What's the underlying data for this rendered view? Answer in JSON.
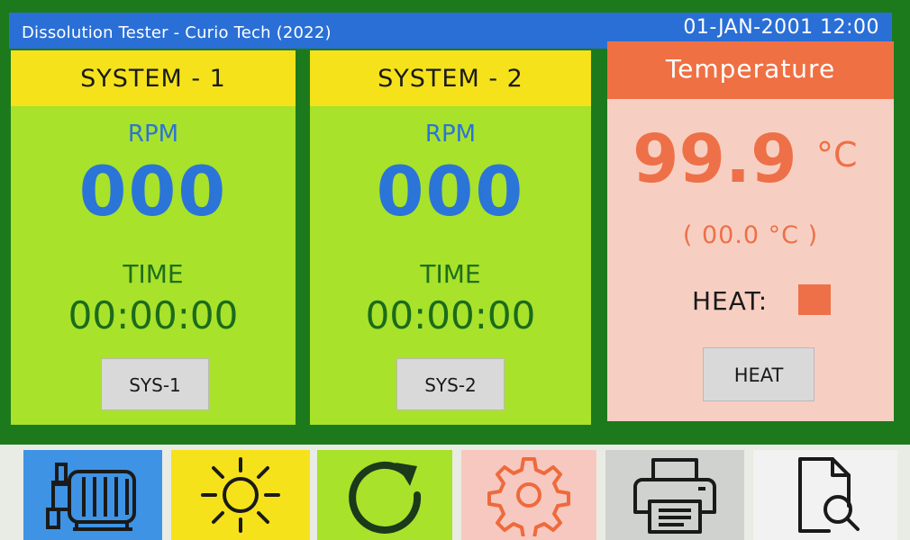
{
  "titlebar": {
    "app_title": "Dissolution Tester - Curio Tech (2022)",
    "datetime": "01-JAN-2001  12:00"
  },
  "systems": [
    {
      "title": "SYSTEM - 1",
      "rpm_label": "RPM",
      "rpm": "000",
      "time_label": "TIME",
      "time": "00:00:00",
      "button": "SYS-1"
    },
    {
      "title": "SYSTEM - 2",
      "rpm_label": "RPM",
      "rpm": "000",
      "time_label": "TIME",
      "time": "00:00:00",
      "button": "SYS-2"
    }
  ],
  "temperature": {
    "title": "Temperature",
    "value": "99.9",
    "unit": "°C",
    "setpoint": "( 00.0 °C )",
    "heat_label": "HEAT:",
    "heat_button": "HEAT"
  },
  "toolbar": [
    {
      "icon": "motor-pump-icon",
      "color": "#3f93e4"
    },
    {
      "icon": "sun-icon",
      "color": "#f6e21a"
    },
    {
      "icon": "refresh-icon",
      "color": "#a8e22a"
    },
    {
      "icon": "gear-icon",
      "color": "#f7c8bf"
    },
    {
      "icon": "printer-icon",
      "color": "#cfd2cf"
    },
    {
      "icon": "document-search-icon",
      "color": "#f2f2f2"
    }
  ],
  "colors": {
    "background": "#1c7a1c",
    "titlebar": "#2a6fd6",
    "system_panel": "#a8e22a",
    "system_header": "#f6e21a",
    "rpm_text": "#2b74d8",
    "temperature_header": "#ef7043",
    "temperature_panel": "#f7cfc2",
    "heat_indicator": "#ee7048"
  }
}
